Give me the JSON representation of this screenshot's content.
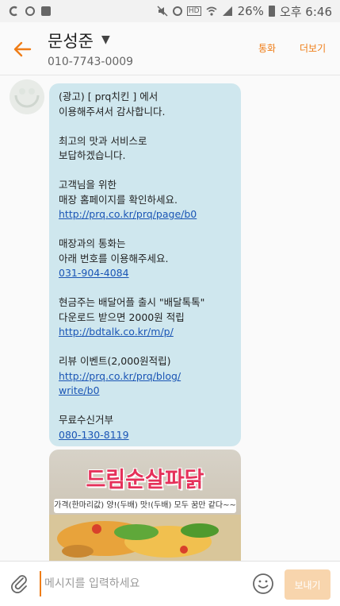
{
  "status_bar": {
    "battery": "26%",
    "time": "오후 6:46"
  },
  "header": {
    "contact_name": "문성준",
    "contact_number": "010-7743-0009",
    "call_label": "통화",
    "more_label": "더보기"
  },
  "message": {
    "lines": [
      {
        "text": "(광고) [ prq치킨 ] 에서",
        "link": false
      },
      {
        "text": "이용해주셔서 감사합니다.",
        "link": false
      },
      {
        "text": "",
        "link": false
      },
      {
        "text": "최고의 맛과 서비스로",
        "link": false
      },
      {
        "text": "보답하겠습니다.",
        "link": false
      },
      {
        "text": "",
        "link": false
      },
      {
        "text": "고객님을 위한",
        "link": false
      },
      {
        "text": "매장 홈페이지를 확인하세요.",
        "link": false
      },
      {
        "text": "http://prq.co.kr/prq/page/b0",
        "link": true
      },
      {
        "text": "",
        "link": false
      },
      {
        "text": "매장과의 통화는",
        "link": false
      },
      {
        "text": "아래 번호를 이용해주세요.",
        "link": false
      },
      {
        "text": "031-904-4084",
        "link": true
      },
      {
        "text": "",
        "link": false
      },
      {
        "text": "현금주는 배달어플 출시 \"배달톡톡\"",
        "link": false
      },
      {
        "text": "다운로드 받으면 2000원 적립",
        "link": false
      },
      {
        "text": "http://bdtalk.co.kr/m/p/",
        "link": true
      },
      {
        "text": "",
        "link": false
      },
      {
        "text": "리뷰 이벤트(2,000원적립)",
        "link": false
      },
      {
        "text": "http://prq.co.kr/prq/blog/",
        "link": true
      },
      {
        "text": "write/b0",
        "link": true
      },
      {
        "text": "",
        "link": false
      },
      {
        "text": "무료수신거부",
        "link": false
      },
      {
        "text": "080-130-8119",
        "link": true
      }
    ],
    "image_title": "드림순살파닭",
    "image_tagline": "가격(한마리값) 양!(두배) 맛!(두배) 모두 꿈만 같다~~"
  },
  "composer": {
    "placeholder": "메시지를 입력하세요",
    "send_label": "보내기"
  },
  "colors": {
    "accent": "#ef7d17",
    "bubble": "#cfe7ee",
    "link": "#1a55b5",
    "send_disabled": "#f8d5ad"
  }
}
